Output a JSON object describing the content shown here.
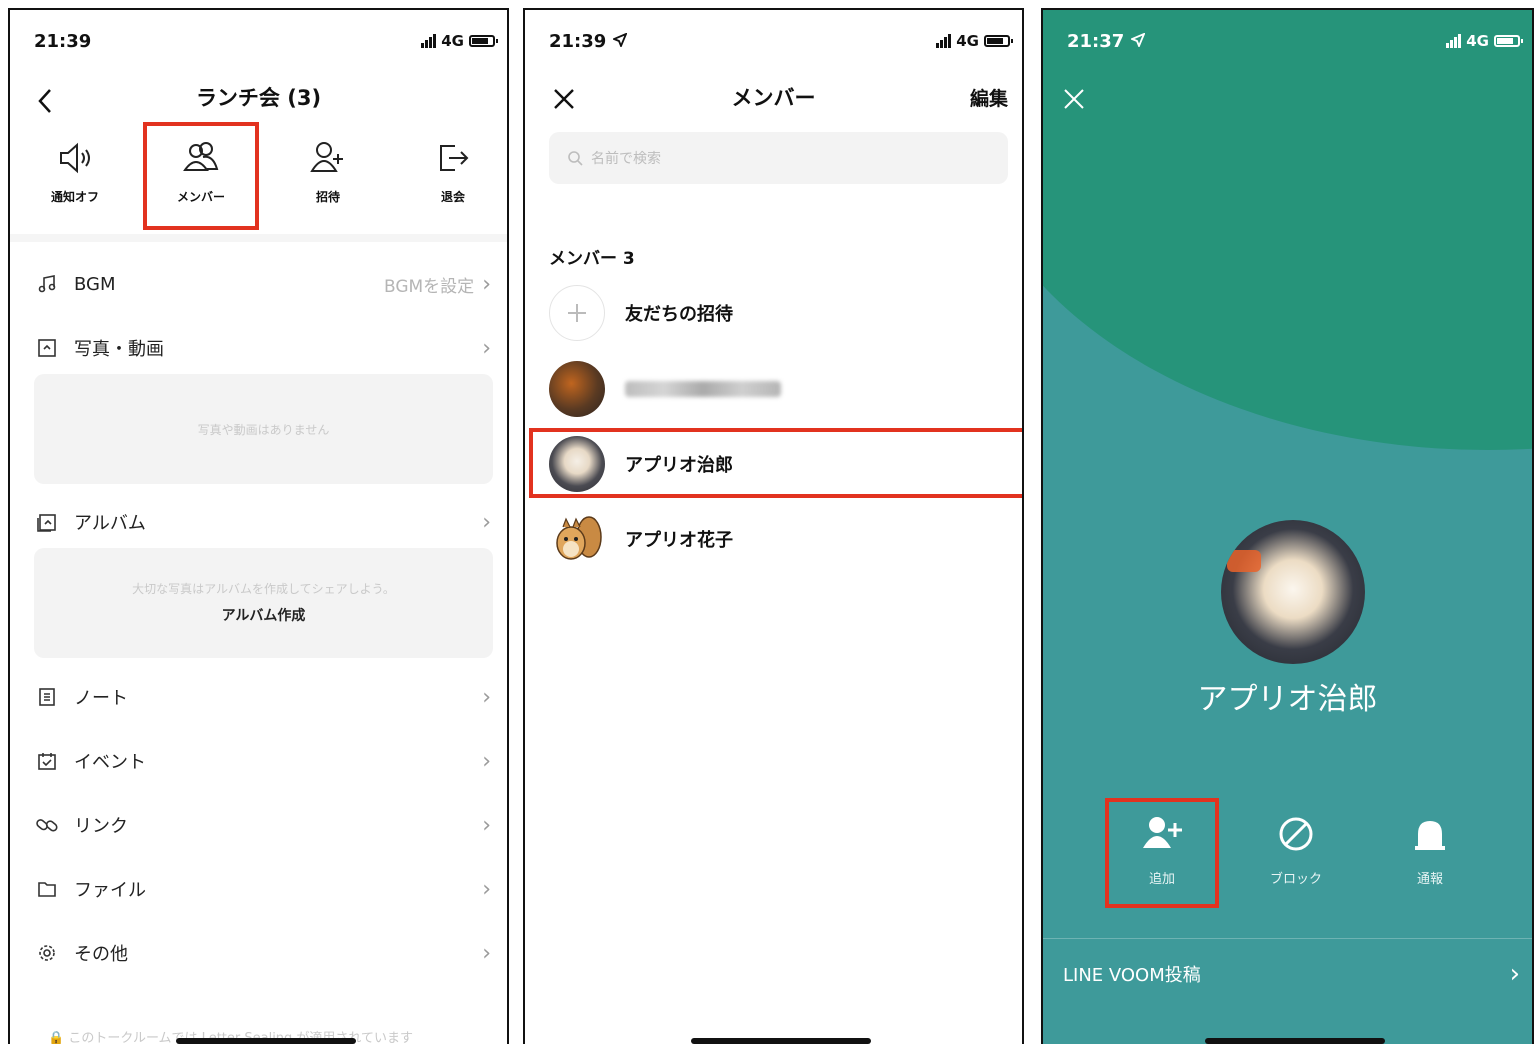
{
  "colors": {
    "highlight": "#e2321f",
    "profile_background": "#3e9a9a",
    "profile_top": "#26947a"
  },
  "panel1": {
    "status": {
      "time": "21:39",
      "network": "4G"
    },
    "title": "ランチ会 (3)",
    "actions": [
      {
        "icon": "speaker-mute-icon",
        "label": "通知オフ"
      },
      {
        "icon": "members-icon",
        "label": "メンバー"
      },
      {
        "icon": "add-friend-icon",
        "label": "招待"
      },
      {
        "icon": "leave-icon",
        "label": "退会"
      }
    ],
    "bgm": {
      "label": "BGM",
      "value": "BGMを設定"
    },
    "photos": {
      "label": "写真・動画",
      "empty_text": "写真や動画はありません"
    },
    "album": {
      "label": "アルバム",
      "hint": "大切な写真はアルバムを作成してシェアしよう。",
      "create_label": "アルバム作成"
    },
    "items": [
      {
        "icon": "note-icon",
        "label": "ノート"
      },
      {
        "icon": "calendar-icon",
        "label": "イベント"
      },
      {
        "icon": "link-icon",
        "label": "リンク"
      },
      {
        "icon": "folder-icon",
        "label": "ファイル"
      },
      {
        "icon": "gear-icon",
        "label": "その他"
      }
    ],
    "footer_note": "このトークルームでは Letter Sealing が適用されています"
  },
  "panel2": {
    "status": {
      "time": "21:39",
      "network": "4G"
    },
    "title": "メンバー",
    "edit_label": "編集",
    "search_placeholder": "名前で検索",
    "section_label": "メンバー 3",
    "invite_label": "友だちの招待",
    "members": [
      {
        "name": "",
        "avatar": "food-avatar",
        "blurred": true
      },
      {
        "name": "アプリオ治郎",
        "avatar": "dog-avatar",
        "highlighted": true
      },
      {
        "name": "アプリオ花子",
        "avatar": "squirrel-avatar"
      }
    ]
  },
  "panel3": {
    "status": {
      "time": "21:37",
      "network": "4G"
    },
    "profile_name": "アプリオ治郎",
    "actions": [
      {
        "icon": "add-friend-icon",
        "label": "追加"
      },
      {
        "icon": "block-icon",
        "label": "ブロック"
      },
      {
        "icon": "report-bell-icon",
        "label": "通報"
      }
    ],
    "voom_label": "LINE VOOM投稿"
  }
}
